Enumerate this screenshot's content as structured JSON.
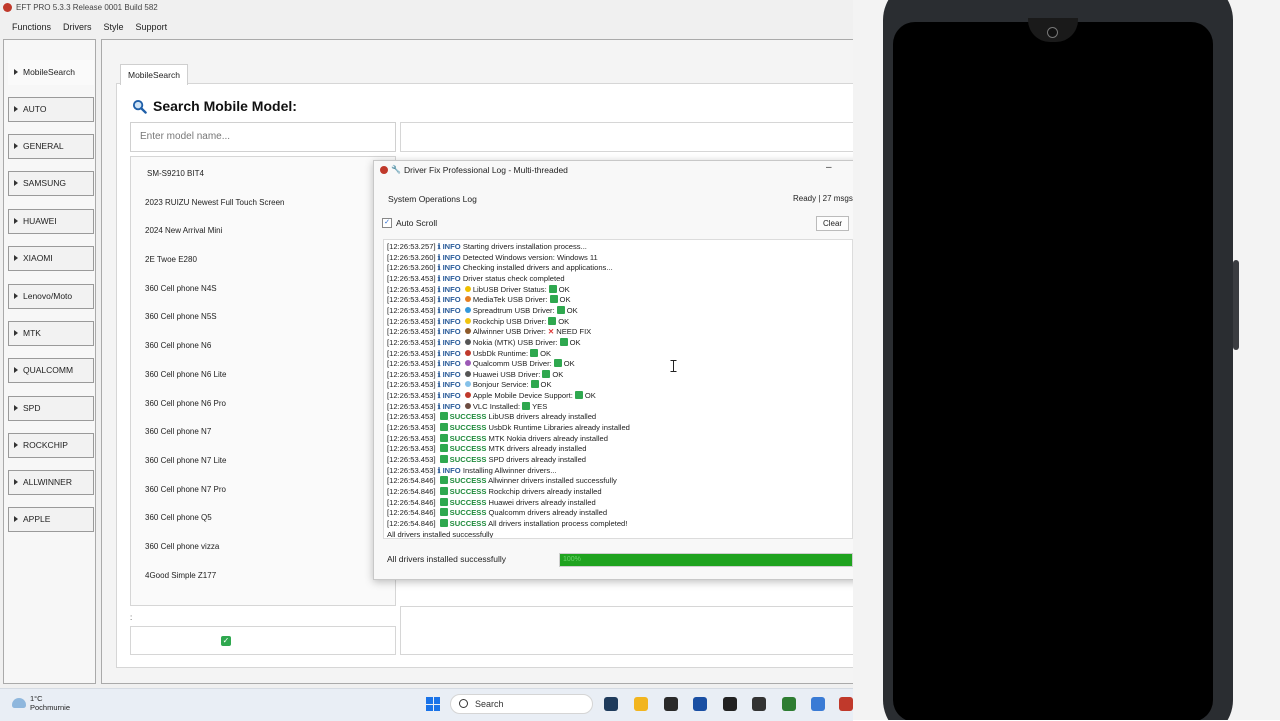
{
  "window": {
    "title": "EFT PRO 5.3.3 Release 0001 Build 582"
  },
  "menu": [
    "Functions",
    "Drivers",
    "Style",
    "Support"
  ],
  "sidebar": {
    "items": [
      {
        "label": "MobileSearch",
        "active": true
      },
      {
        "label": "AUTO"
      },
      {
        "label": "GENERAL"
      },
      {
        "label": "SAMSUNG"
      },
      {
        "label": "HUAWEI"
      },
      {
        "label": "XIAOMI"
      },
      {
        "label": "Lenovo/Moto"
      },
      {
        "label": "MTK"
      },
      {
        "label": "QUALCOMM"
      },
      {
        "label": "SPD"
      },
      {
        "label": "ROCKCHIP"
      },
      {
        "label": "ALLWINNER"
      },
      {
        "label": "APPLE"
      }
    ]
  },
  "main": {
    "tab": "MobileSearch",
    "search_title": "Search Mobile Model:",
    "search_placeholder": "Enter model name...",
    "colon": ":",
    "models": [
      "SM-S9210 BIT4",
      "2023 RUIZU Newest Full Touch Screen",
      "2024 New Arrival Mini",
      "2E Twoe E280",
      "360 Cell phone N4S",
      "360 Cell phone N5S",
      "360 Cell phone N6",
      "360 Cell phone N6 Lite",
      "360 Cell phone N6 Pro",
      "360 Cell phone N7",
      "360 Cell phone N7 Lite",
      "360 Cell phone N7 Pro",
      "360 Cell phone Q5",
      "360 Cell phone vizza",
      "4Good Simple Z177"
    ]
  },
  "dialog": {
    "title": "Driver Fix Professional Log - Multi-threaded",
    "minimize": "–",
    "section": "System Operations Log",
    "status": "Ready | 27 msgs |",
    "autoscroll_label": "Auto Scroll",
    "clear_label": "Clear",
    "log": [
      {
        "t": "[12:26:53.257]",
        "lvl": "INFO",
        "msg": "Starting drivers installation process..."
      },
      {
        "t": "[12:26:53.260]",
        "lvl": "INFO",
        "msg": "Detected Windows version: Windows 11"
      },
      {
        "t": "[12:26:53.260]",
        "lvl": "INFO",
        "msg": "Checking installed drivers and applications..."
      },
      {
        "t": "[12:26:53.453]",
        "lvl": "INFO",
        "msg": "Driver status check completed"
      },
      {
        "t": "[12:26:53.453]",
        "lvl": "INFO",
        "msg": "LibUSB Driver Status:",
        "res": "OK",
        "dot": "#f0c000"
      },
      {
        "t": "[12:26:53.453]",
        "lvl": "INFO",
        "msg": "MediaTek USB Driver:",
        "res": "OK",
        "dot": "#e67e22"
      },
      {
        "t": "[12:26:53.453]",
        "lvl": "INFO",
        "msg": "Spreadtrum USB Driver:",
        "res": "OK",
        "dot": "#3498db"
      },
      {
        "t": "[12:26:53.453]",
        "lvl": "INFO",
        "msg": "Rockchip USB Driver:",
        "res": "OK",
        "dot": "#f1c40f"
      },
      {
        "t": "[12:26:53.453]",
        "lvl": "INFO",
        "msg": "Allwinner USB Driver:",
        "res": "NEED FIX",
        "fail": true,
        "dot": "#8e5a2a"
      },
      {
        "t": "[12:26:53.453]",
        "lvl": "INFO",
        "msg": "Nokia (MTK) USB Driver:",
        "res": "OK",
        "dot": "#555555"
      },
      {
        "t": "[12:26:53.453]",
        "lvl": "INFO",
        "msg": "UsbDk Runtime:",
        "res": "OK",
        "dot": "#c0392b"
      },
      {
        "t": "[12:26:53.453]",
        "lvl": "INFO",
        "msg": "Qualcomm USB Driver:",
        "res": "OK",
        "dot": "#9b59b6"
      },
      {
        "t": "[12:26:53.453]",
        "lvl": "INFO",
        "msg": "Huawei USB Driver:",
        "res": "OK",
        "dot": "#555555"
      },
      {
        "t": "[12:26:53.453]",
        "lvl": "INFO",
        "msg": "Bonjour Service:",
        "res": "OK",
        "dot": "#85c1e9"
      },
      {
        "t": "[12:26:53.453]",
        "lvl": "INFO",
        "msg": "Apple Mobile Device Support:",
        "res": "OK",
        "dot": "#c0392b"
      },
      {
        "t": "[12:26:53.453]",
        "lvl": "INFO",
        "msg": "VLC Installed:",
        "res": "YES",
        "dot": "#6d4c41"
      },
      {
        "t": "[12:26:53.453]",
        "lvl": "SUCCESS",
        "msg": "LibUSB drivers already installed"
      },
      {
        "t": "[12:26:53.453]",
        "lvl": "SUCCESS",
        "msg": "UsbDk Runtime Libraries already installed"
      },
      {
        "t": "[12:26:53.453]",
        "lvl": "SUCCESS",
        "msg": "MTK Nokia drivers already installed"
      },
      {
        "t": "[12:26:53.453]",
        "lvl": "SUCCESS",
        "msg": "MTK drivers already installed"
      },
      {
        "t": "[12:26:53.453]",
        "lvl": "SUCCESS",
        "msg": "SPD drivers already installed"
      },
      {
        "t": "[12:26:53.453]",
        "lvl": "INFO",
        "msg": "Installing Allwinner drivers..."
      },
      {
        "t": "[12:26:54.846]",
        "lvl": "SUCCESS",
        "msg": "Allwinner drivers installed successfully"
      },
      {
        "t": "[12:26:54.846]",
        "lvl": "SUCCESS",
        "msg": "Rockchip drivers already installed"
      },
      {
        "t": "[12:26:54.846]",
        "lvl": "SUCCESS",
        "msg": "Huawei drivers already installed"
      },
      {
        "t": "[12:26:54.846]",
        "lvl": "SUCCESS",
        "msg": "Qualcomm drivers already installed"
      },
      {
        "t": "[12:26:54.846]",
        "lvl": "SUCCESS",
        "msg": "All drivers installation process completed!"
      },
      {
        "t": "",
        "lvl": "",
        "msg": "All drivers installed successfully"
      }
    ],
    "footer_text": "All drivers installed successfully",
    "progress_fraction": 1.0,
    "progress_label": "100%"
  },
  "taskbar": {
    "temp": "1°C",
    "weather": "Pochmurnie",
    "search": "Search",
    "icon_colors": [
      "#1f3b5c",
      "#f2b51f",
      "#2a2a2a",
      "#1a4fa3",
      "#222222",
      "#333333",
      "#2e7d32",
      "#3a7bd5",
      "#c0392b"
    ]
  },
  "colors": {
    "accent": "#1fa31f",
    "info": "#2a5c9a",
    "success": "#1f8a3b"
  }
}
